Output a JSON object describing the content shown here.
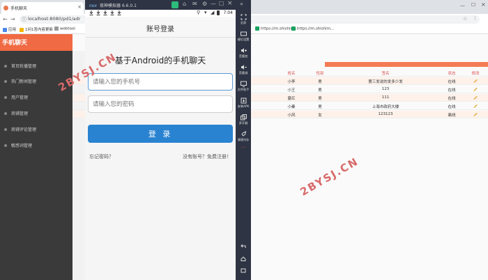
{
  "browser": {
    "tab_title": "手机聊天",
    "close_glyph": "×",
    "new_tab_glyph": "+",
    "url": "localhost:8080/pd1/adr",
    "url_right_1": "https://m.shishim...",
    "url_right_2": "https://m.shishim...",
    "bookmarks": [
      "应用",
      "1问1答内容更新",
      "webtool"
    ]
  },
  "admin": {
    "title": "手机聊天",
    "menu": [
      "首页轮播管理",
      "热门新闻管理",
      "用户管理",
      "商铺管理",
      "商铺评论管理",
      "敏感词管理"
    ],
    "table": {
      "headers": [
        "姓名",
        "性别",
        "签名",
        "状态",
        "修改"
      ],
      "rows": [
        [
          "小李",
          "男",
          "第三发说的发多少发",
          "在线"
        ],
        [
          "小王",
          "男",
          "123",
          "在线"
        ],
        [
          "夏红",
          "男",
          "111",
          "在线"
        ],
        [
          "小秦",
          "男",
          "上海市政府大楼",
          "在线"
        ],
        [
          "小风",
          "女",
          "123123",
          "离线"
        ]
      ]
    }
  },
  "emulator": {
    "title": "夜神模拟器 6.6.0.1",
    "logo": "nox",
    "tools": [
      "全屏",
      "键位设置",
      "音量加",
      "音量减",
      "文件助手",
      "安装APK",
      "多开器",
      "清理内存"
    ]
  },
  "phone": {
    "status_time": "7:04",
    "appbar_title": "账号登录",
    "heading": "基于Android的手机聊天",
    "phone_placeholder": "请输入您的手机号",
    "password_placeholder": "请输入您的密码",
    "login_label": "登 录",
    "forgot_link": "忘记密码？",
    "register_link": "没有账号？免费注册！"
  },
  "watermark": "2BYSJ.CN",
  "colors": {
    "accent_orange": "#f06a43",
    "button_blue": "#2a83d1",
    "emulator_dark": "#2e3444",
    "watermark_red": "#d86a6a"
  }
}
